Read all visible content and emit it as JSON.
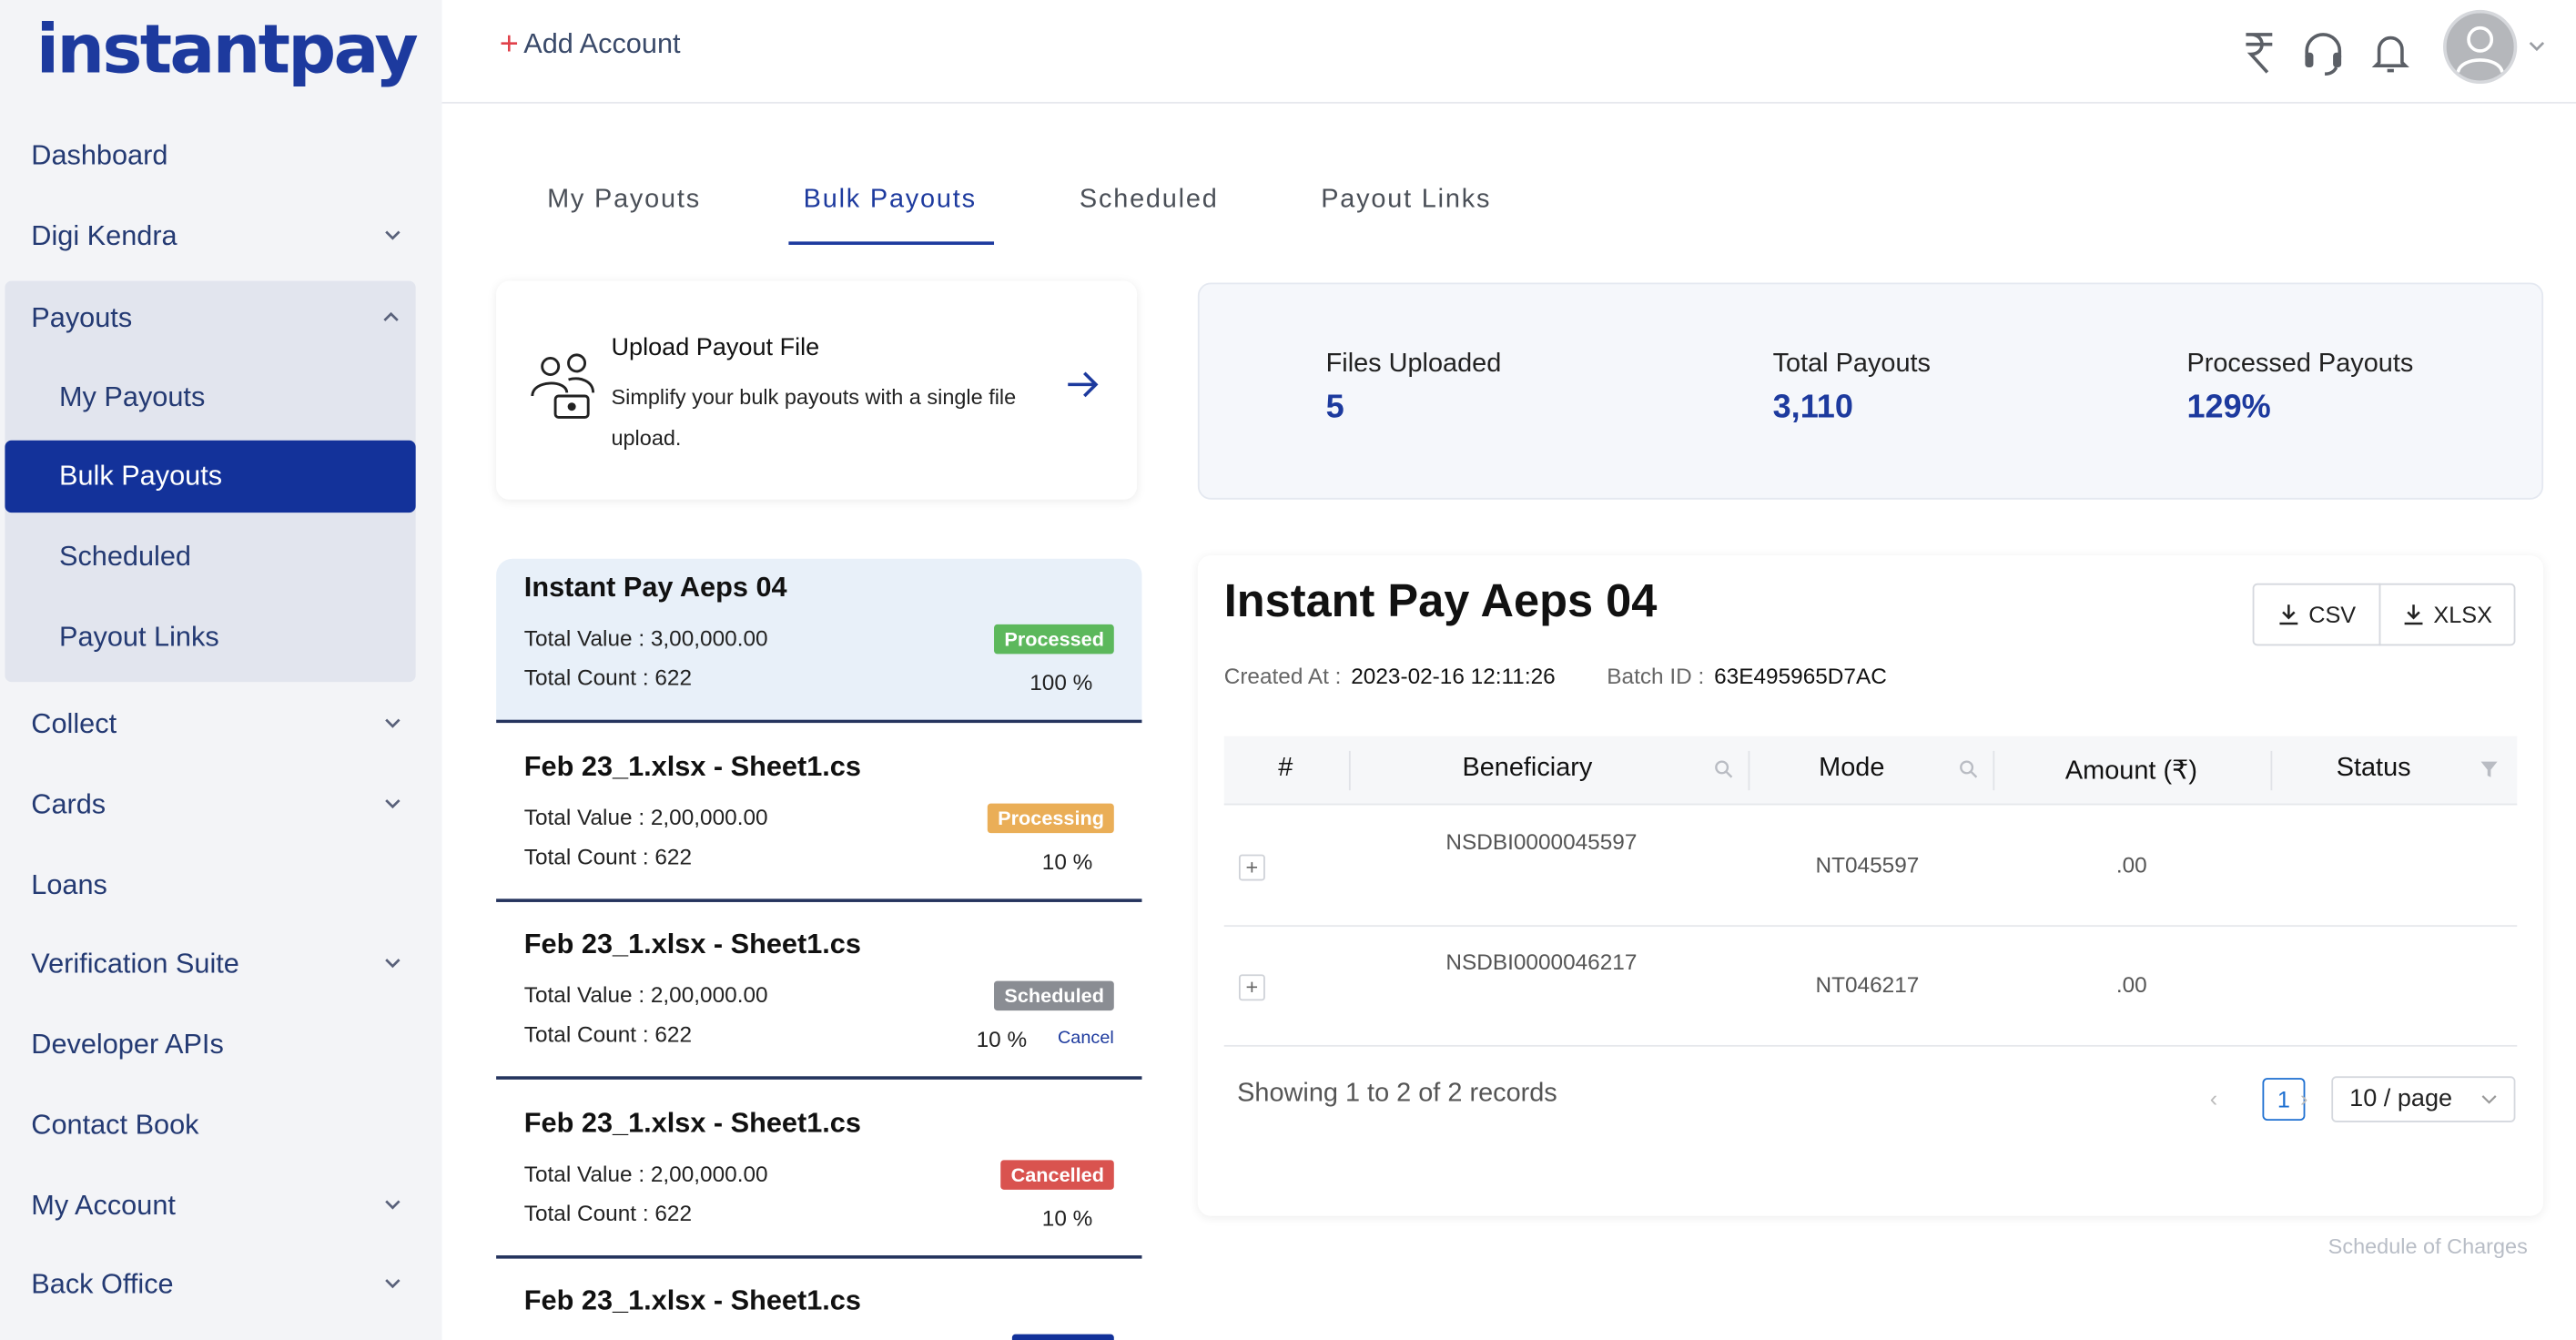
{
  "brand": {
    "logo_text": "instantpay",
    "accent": "#13329a",
    "logo_color": "#1d3a9e"
  },
  "header": {
    "add_account": "Add Account",
    "icons": [
      "rupee-icon",
      "headset-icon",
      "bell-icon",
      "avatar-icon",
      "chevron-down-icon"
    ]
  },
  "sidebar": {
    "items": [
      {
        "label": "Dashboard",
        "has_chevron": false
      },
      {
        "label": "Digi Kendra",
        "has_chevron": true
      },
      {
        "label": "Payouts",
        "has_chevron": true,
        "expanded": true
      },
      {
        "label": "Collect",
        "has_chevron": true
      },
      {
        "label": "Cards",
        "has_chevron": true
      },
      {
        "label": "Loans",
        "has_chevron": false
      },
      {
        "label": "Verification Suite",
        "has_chevron": true
      },
      {
        "label": "Developer APIs",
        "has_chevron": false
      },
      {
        "label": "Contact Book",
        "has_chevron": false
      },
      {
        "label": "My Account",
        "has_chevron": true
      },
      {
        "label": "Back Office",
        "has_chevron": true
      }
    ],
    "payouts_sub": [
      {
        "label": "My Payouts",
        "active": false
      },
      {
        "label": "Bulk Payouts",
        "active": true
      },
      {
        "label": "Scheduled",
        "active": false
      },
      {
        "label": "Payout Links",
        "active": false
      }
    ]
  },
  "tabs": [
    {
      "label": "My Payouts",
      "active": false
    },
    {
      "label": "Bulk Payouts",
      "active": true
    },
    {
      "label": "Scheduled",
      "active": false
    },
    {
      "label": "Payout Links",
      "active": false
    }
  ],
  "upload": {
    "title": "Upload Payout File",
    "description": "Simplify your bulk payouts with a single file upload."
  },
  "stats": [
    {
      "label": "Files Uploaded",
      "value": "5"
    },
    {
      "label": "Total Payouts",
      "value": "3,110"
    },
    {
      "label": "Processed Payouts",
      "value": "129%"
    }
  ],
  "batches": [
    {
      "name": "Instant Pay Aeps 04",
      "total_value": "Total Value : 3,00,000.00",
      "total_count": "Total Count : 622",
      "status": "Processed",
      "status_color": "#5cb85c",
      "percent": "100 %",
      "cancel": ""
    },
    {
      "name": "Feb 23_1.xlsx - Sheet1.cs",
      "total_value": "Total Value : 2,00,000.00",
      "total_count": "Total Count : 622",
      "status": "Processing",
      "status_color": "#eaae57",
      "percent": "10 %",
      "cancel": ""
    },
    {
      "name": "Feb 23_1.xlsx - Sheet1.cs",
      "total_value": "Total Value : 2,00,000.00",
      "total_count": "Total Count : 622",
      "status": "Scheduled",
      "status_color": "#8a8d93",
      "percent": "10 %",
      "cancel": "Cancel"
    },
    {
      "name": "Feb 23_1.xlsx - Sheet1.cs",
      "total_value": "Total Value : 2,00,000.00",
      "total_count": "Total Count : 622",
      "status": "Cancelled",
      "status_color": "#d9534f",
      "percent": "10 %",
      "cancel": ""
    },
    {
      "name": "Feb 23_1.xlsx - Sheet1.cs",
      "total_value": "",
      "total_count": "",
      "status": "",
      "status_color": "#13329a",
      "percent": "",
      "cancel": ""
    }
  ],
  "detail": {
    "title": "Instant Pay Aeps 04",
    "created_label": "Created At :",
    "created_value": "2023-02-16 12:11:26",
    "batch_label": "Batch ID :",
    "batch_value": "63E495965D7AC",
    "csv_label": "CSV",
    "xlsx_label": "XLSX",
    "columns": [
      "#",
      "Beneficiary",
      "Mode",
      "Amount (₹)",
      "Status"
    ],
    "rows": [
      {
        "beneficiary": "NSDBI0000045597",
        "mode": "NT045597",
        "amount": ".00",
        "status": ""
      },
      {
        "beneficiary": "NSDBI0000046217",
        "mode": "NT046217",
        "amount": ".00",
        "status": ""
      }
    ],
    "showing": "Showing 1 to 2 of 2 records",
    "page": "1",
    "page_size": "10 / page"
  },
  "footer": {
    "schedule_link": "Schedule of Charges"
  }
}
